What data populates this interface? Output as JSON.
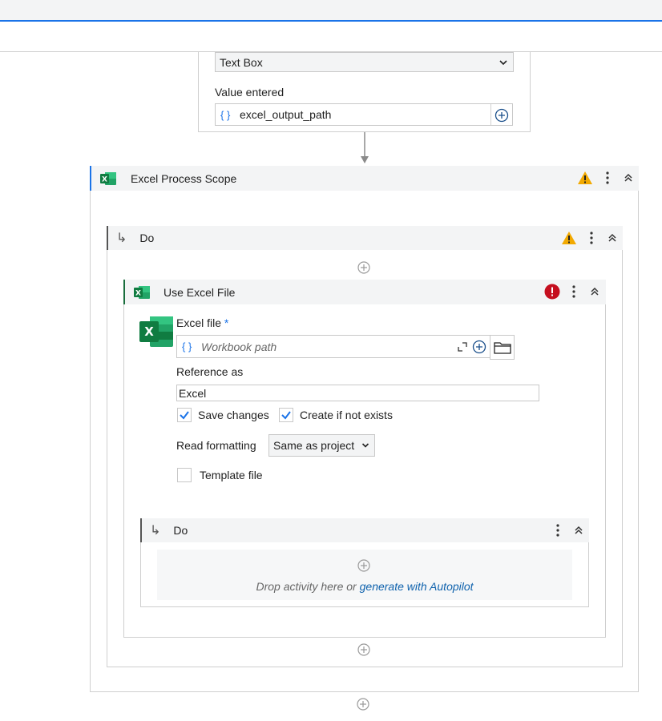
{
  "top_card": {
    "type_select": "Text Box",
    "value_label": "Value entered",
    "value": "excel_output_path",
    "braces": "{ }"
  },
  "excel_scope": {
    "title": "Excel Process Scope"
  },
  "do_outer": {
    "title": "Do",
    "arrow": "↳"
  },
  "use_excel": {
    "title": "Use Excel File",
    "excel_file_label": "Excel file",
    "required_mark": "*",
    "workbook_placeholder": "Workbook path",
    "braces": "{ }",
    "reference_label": "Reference as",
    "reference_value": "Excel",
    "save_changes_label": "Save changes",
    "create_if_not_exists_label": "Create if not exists",
    "read_formatting_label": "Read formatting",
    "read_formatting_value": "Same as project",
    "template_file_label": "Template file",
    "excel_icon_letter": "X"
  },
  "do_inner": {
    "title": "Do",
    "arrow": "↳",
    "drop_text_prefix": "Drop activity here or ",
    "drop_link": "generate with Autopilot"
  },
  "colors": {
    "accent_blue": "#1a73e8",
    "excel_green": "#1a6e3d",
    "warning": "#f2a900",
    "error": "#c50f1f"
  }
}
